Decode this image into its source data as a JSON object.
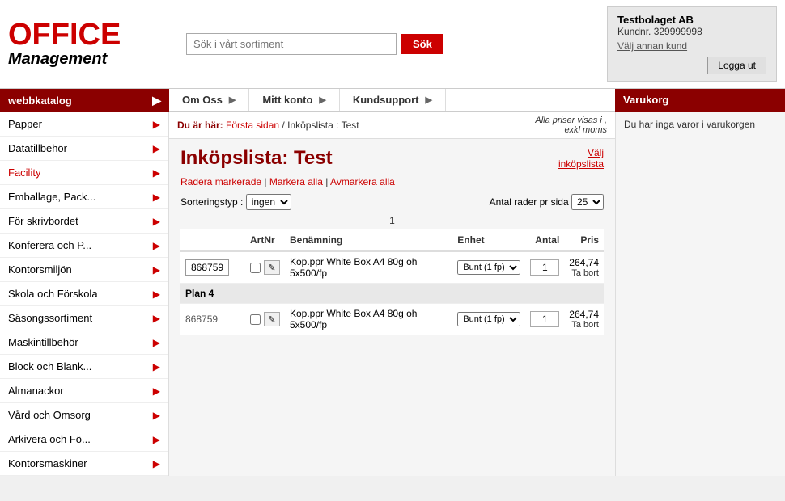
{
  "header": {
    "logo_office": "OFFICE",
    "logo_mgmt": "Management",
    "search_placeholder": "Sök i vårt sortiment",
    "search_button": "Sök",
    "user_company": "Testbolaget AB",
    "user_kundnr": "Kundnr. 329999998",
    "user_switch": "Välj annan kund",
    "logout_button": "Logga ut"
  },
  "nav": {
    "sidebar_label": "webbkatalog",
    "top_items": [
      {
        "label": "Om Oss"
      },
      {
        "label": "Mitt konto"
      },
      {
        "label": "Kundsupport"
      }
    ],
    "cart_label": "Varukorg"
  },
  "sidebar": {
    "items": [
      {
        "label": "Papper"
      },
      {
        "label": "Datatillbehör"
      },
      {
        "label": "Facility"
      },
      {
        "label": "Emballage, Pack..."
      },
      {
        "label": "För skrivbordet"
      },
      {
        "label": "Konferera och P..."
      },
      {
        "label": "Kontorsmiljön"
      },
      {
        "label": "Skola och Förskola"
      },
      {
        "label": "Säsongssortiment"
      },
      {
        "label": "Maskintillbehör"
      },
      {
        "label": "Block och Blank..."
      },
      {
        "label": "Almanackor"
      },
      {
        "label": "Vård och Omsorg"
      },
      {
        "label": "Arkivera och Fö..."
      },
      {
        "label": "Kontorsmaskiner"
      }
    ]
  },
  "breadcrumb": {
    "label": "Du är här:",
    "first": "Första sidan",
    "separator1": "/",
    "second": "Inköpslista",
    "separator2": ":",
    "third": "Test",
    "price_note": "Alla priser visas i ,\nexkl moms"
  },
  "content": {
    "page_title": "Inköpslista: Test",
    "select_list": "Välj\ninköpslista",
    "action_delete": "Radera markerade",
    "action_select_all": "Markera alla",
    "action_deselect": "Avmarkera alla",
    "sort_label": "Sorteringstyp :",
    "sort_value": "ingen",
    "rows_label": "Antal rader pr sida",
    "rows_value": "25",
    "pagination": "1",
    "table": {
      "headers": [
        "ArtNr",
        "Benämning",
        "Enhet",
        "Antal",
        "Pris"
      ],
      "rows": [
        {
          "artnr": "868759",
          "name": "Kop.ppr White Box A4 80g oh 5x500/fp",
          "unit": "Bunt (1 fp)",
          "qty": "1",
          "price": "264,74",
          "type": "item"
        },
        {
          "plan": "Plan 4",
          "type": "plan"
        },
        {
          "artnr": "868759",
          "name": "Kop.ppr White Box A4 80g oh 5x500/fp",
          "unit": "Bunt (1 fp)",
          "qty": "1",
          "price": "264,74",
          "type": "item"
        }
      ]
    }
  },
  "cart": {
    "empty_text": "Du har inga varor i varukorgen"
  }
}
